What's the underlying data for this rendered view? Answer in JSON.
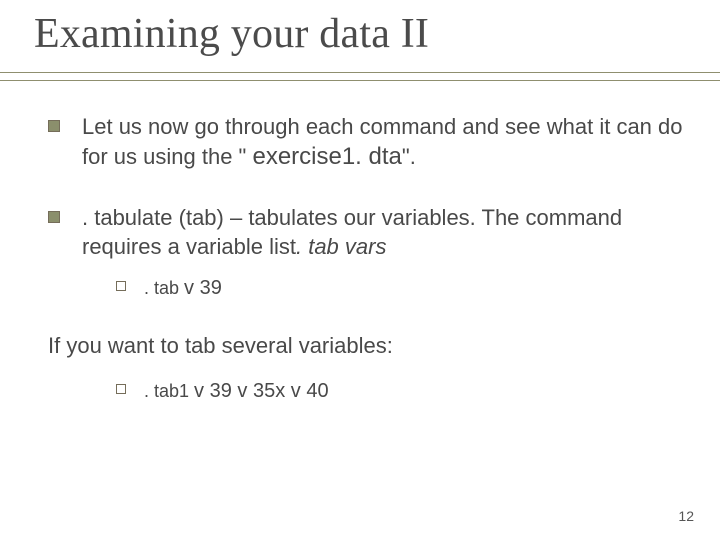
{
  "title": "Examining your data II",
  "bullets": {
    "b1": {
      "text_a": "Let us now go through each command and see what it can do for us using the \" ",
      "text_b": "exercise1. dta",
      "text_c": "\"."
    },
    "b2": {
      "text_a": ". tabulate",
      "text_b": " (tab) – tabulates our variables. The command requires a variable list",
      "text_c": ". tab vars"
    }
  },
  "sub1": {
    "text_a": ". tab  ",
    "text_b": "v 39"
  },
  "after": "If you want to tab several variables:",
  "sub2": {
    "text_a": ". tab1 ",
    "text_b": "v 39 v 35x v 40"
  },
  "page_number": "12"
}
